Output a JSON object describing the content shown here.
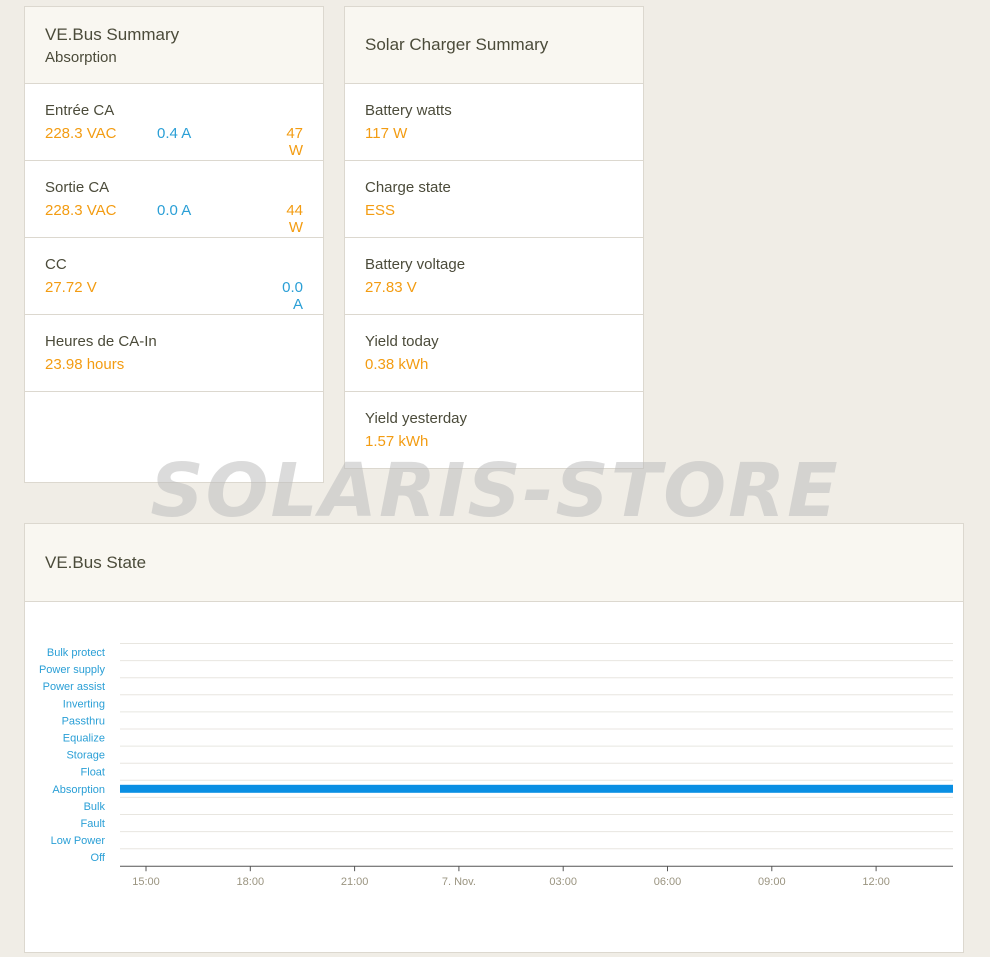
{
  "vebus_summary": {
    "title": "VE.Bus Summary",
    "state": "Absorption",
    "rows": [
      {
        "label": "Entrée CA",
        "v1": "228.3 VAC",
        "v2": "0.4 A",
        "v3": "47 W"
      },
      {
        "label": "Sortie CA",
        "v1": "228.3 VAC",
        "v2": "0.0 A",
        "v3": "44 W"
      },
      {
        "label": "CC",
        "v1": "27.72 V",
        "v2": "",
        "v3": "0.0 A"
      },
      {
        "label": "Heures de CA-In",
        "v1": "23.98 hours",
        "v2": "",
        "v3": ""
      }
    ]
  },
  "solar_summary": {
    "title": "Solar Charger Summary",
    "rows": [
      {
        "label": "Battery watts",
        "value": "117 W"
      },
      {
        "label": "Charge state",
        "value": "ESS"
      },
      {
        "label": "Battery voltage",
        "value": "27.83 V"
      },
      {
        "label": "Yield today",
        "value": "0.38 kWh"
      },
      {
        "label": "Yield yesterday",
        "value": "1.57 kWh"
      }
    ]
  },
  "vebus_state": {
    "title": "VE.Bus State"
  },
  "watermark": "SOLARIS-STORE",
  "colors": {
    "accent_orange": "#f39c12",
    "accent_blue": "#2a9fd6",
    "series_bar": "#0a8fe3"
  },
  "chart_data": {
    "type": "line",
    "categories": [
      "Bulk protect",
      "Power supply",
      "Power assist",
      "Inverting",
      "Passthru",
      "Equalize",
      "Storage",
      "Float",
      "Absorption",
      "Bulk",
      "Fault",
      "Low Power",
      "Off"
    ],
    "x_ticks": [
      "15:00",
      "18:00",
      "21:00",
      "7. Nov.",
      "03:00",
      "06:00",
      "09:00",
      "12:00"
    ],
    "series": [
      {
        "values": [
          {
            "x_start": "14:30",
            "x_end": "14:00 (next day)",
            "state": "Absorption"
          }
        ]
      }
    ],
    "grid": true
  }
}
